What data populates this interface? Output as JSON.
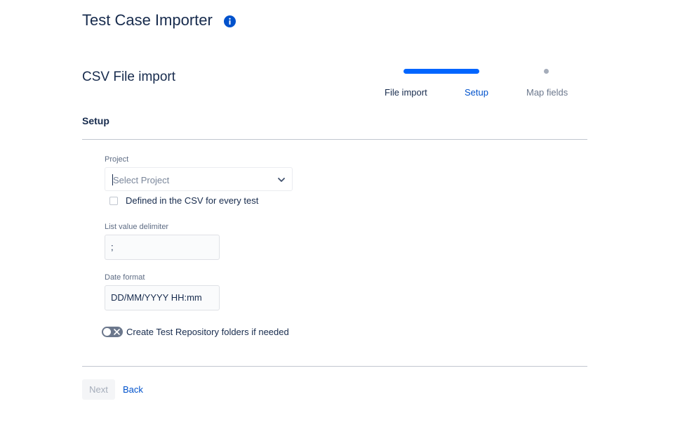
{
  "header": {
    "title": "Test Case Importer",
    "info_icon": "info-icon",
    "accent_color": "#0052cc"
  },
  "section": {
    "title": "CSV File import"
  },
  "stepper": {
    "steps": [
      {
        "label": "File import",
        "state": "completed"
      },
      {
        "label": "Setup",
        "state": "current"
      },
      {
        "label": "Map fields",
        "state": "upcoming"
      }
    ],
    "active_color": "#0065ff"
  },
  "setup": {
    "title": "Setup",
    "project": {
      "label": "Project",
      "placeholder": "Select Project",
      "checkbox_label": "Defined in the CSV for every test",
      "checkbox_checked": false
    },
    "list_delimiter": {
      "label": "List value delimiter",
      "value": ";"
    },
    "date_format": {
      "label": "Date format",
      "value": "DD/MM/YYYY HH:mm"
    },
    "toggle": {
      "label": "Create Test Repository folders if needed",
      "on": false
    }
  },
  "footer": {
    "next_label": "Next",
    "back_label": "Back"
  }
}
